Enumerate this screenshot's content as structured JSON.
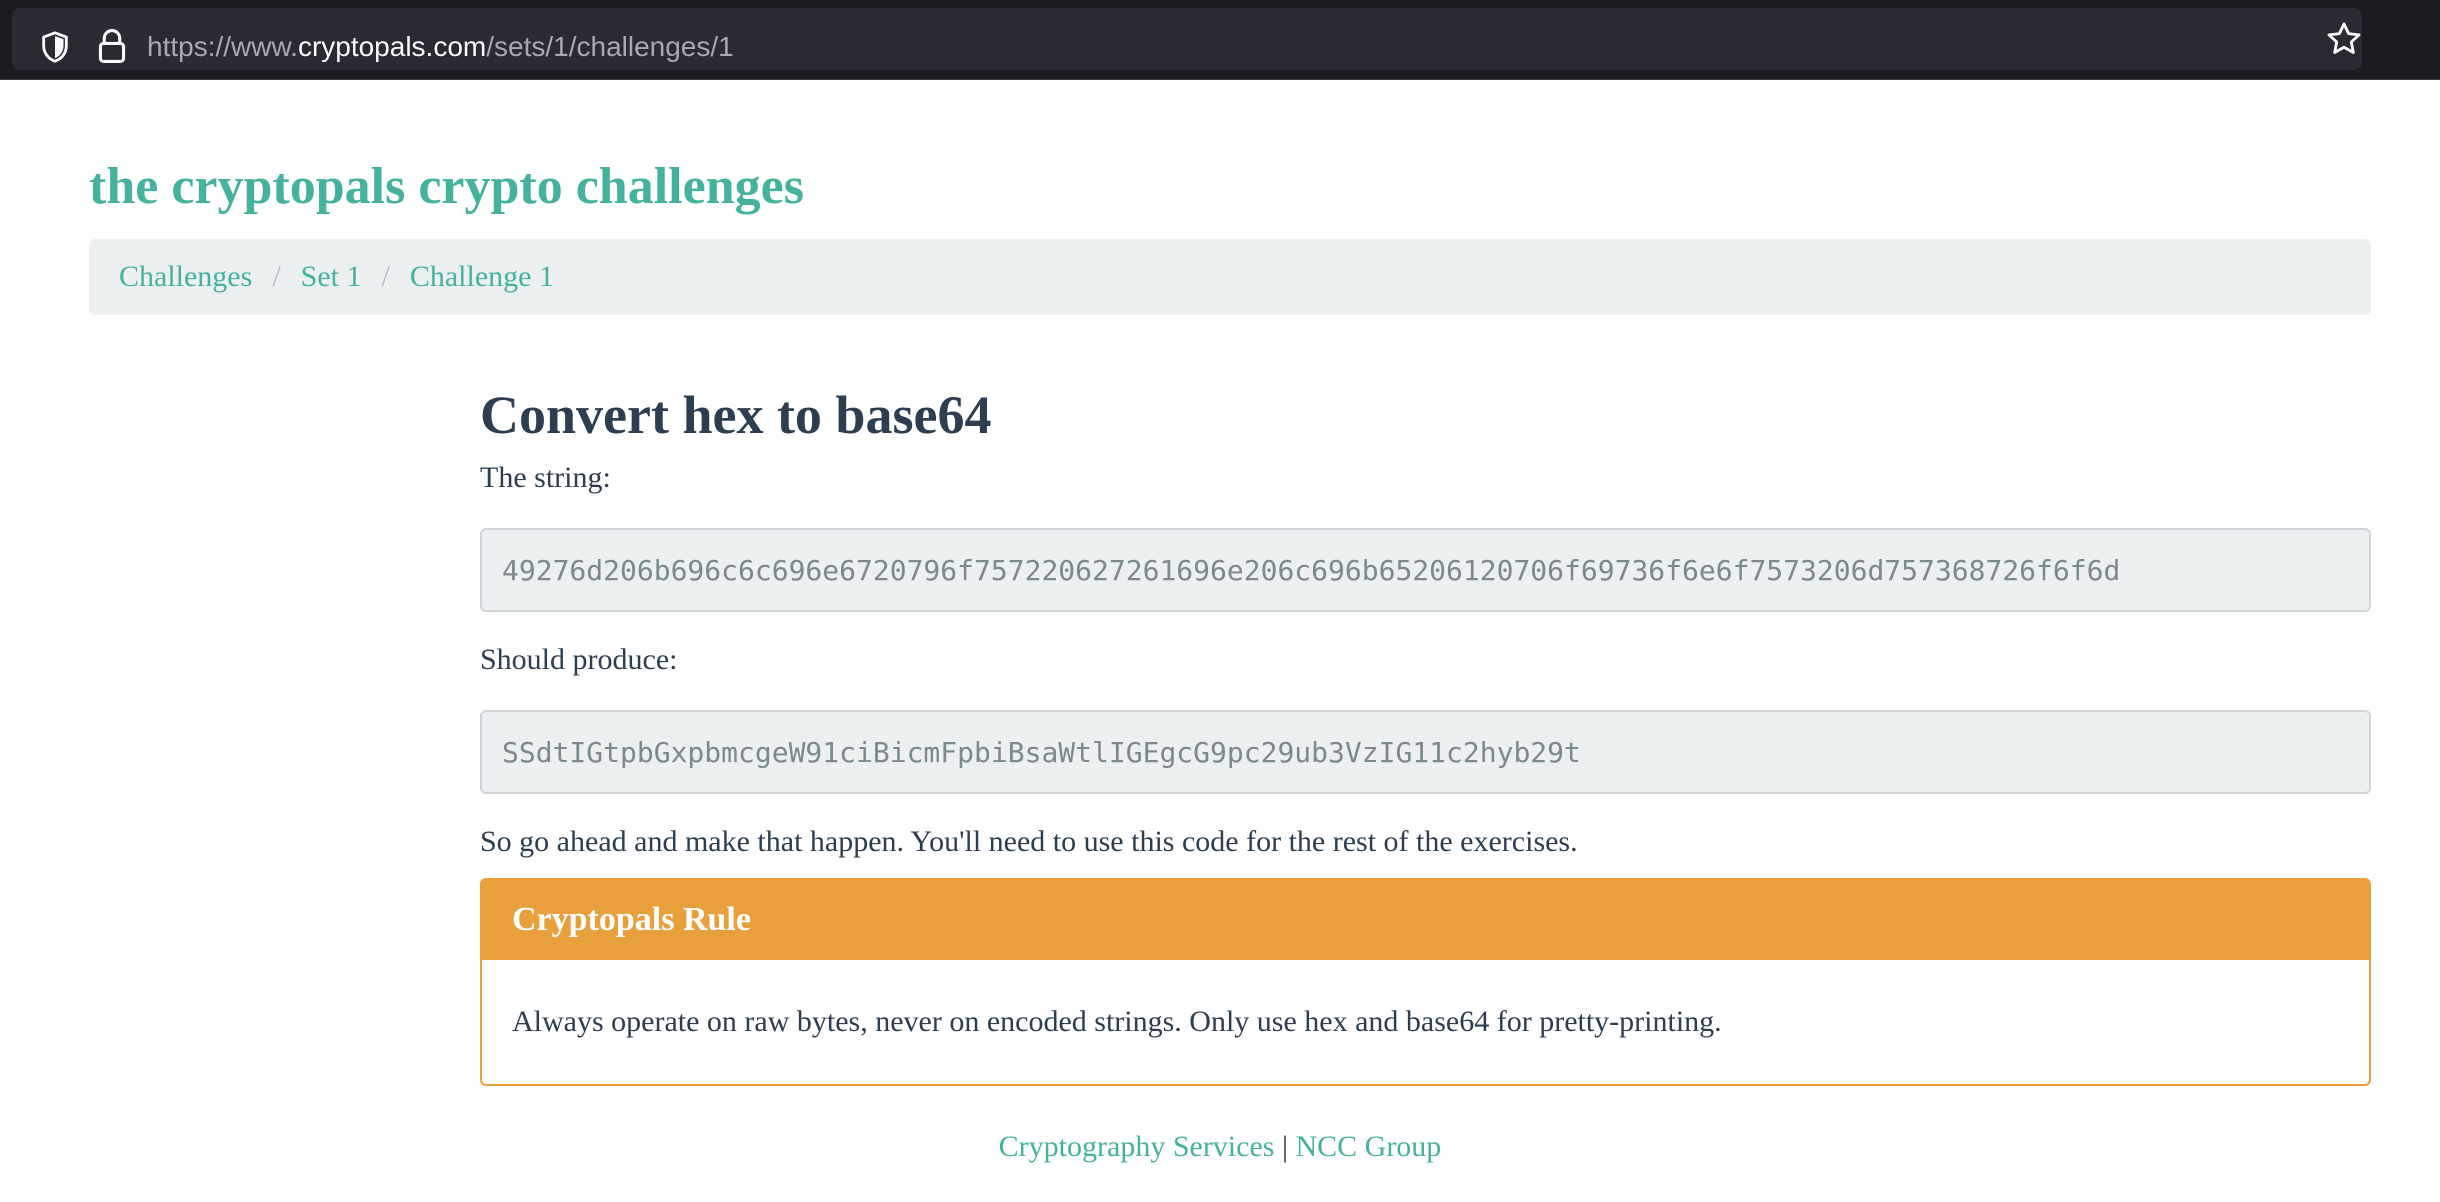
{
  "browser": {
    "url_prefix": "https://www.",
    "url_domain": "cryptopals.com",
    "url_path": "/sets/1/challenges/1"
  },
  "site": {
    "title": "the cryptopals crypto challenges"
  },
  "breadcrumb": {
    "items": [
      "Challenges",
      "Set 1",
      "Challenge 1"
    ],
    "separator": "/"
  },
  "challenge": {
    "title": "Convert hex to base64",
    "intro": "The string:",
    "input_hex": "49276d206b696c6c696e6720796f757220627261696e206c696b65206120706f69736f6e6f7573206d757368726f6f6d",
    "produce_label": "Should produce:",
    "output_base64": "SSdtIGtpbGxpbmcgeW91ciBicmFpbiBsaWtlIGEgcG9pc29ub3VzIG11c2hyb29t",
    "outro": "So go ahead and make that happen. You'll need to use this code for the rest of the exercises."
  },
  "rule": {
    "heading": "Cryptopals Rule",
    "text": "Always operate on raw bytes, never on encoded strings. Only use hex and base64 for pretty-printing."
  },
  "footer": {
    "link1": "Cryptography Services",
    "divider": "|",
    "link2": "NCC Group"
  },
  "colors": {
    "accent": "#45b29d",
    "warning": "#e8a03c",
    "text": "#2c3e50",
    "well": "#ecf0f1"
  }
}
